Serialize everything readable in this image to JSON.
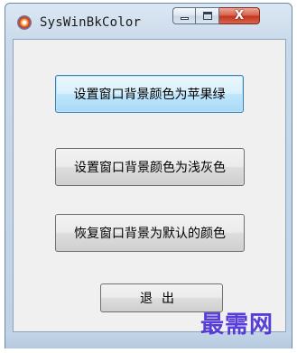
{
  "window": {
    "title": "SysWinBkColor",
    "icon": "color-wheel-icon",
    "caption": {
      "minimize": "minimize-icon",
      "maximize": "maximize-icon",
      "close": "close-icon",
      "close_glyph": "X"
    }
  },
  "buttons": {
    "apple_green": "设置窗口背景颜色为苹果绿",
    "light_gray": "设置窗口背景颜色为浅灰色",
    "restore_default": "恢复窗口背景为默认的颜色",
    "exit": "退出"
  },
  "watermark": "最需网",
  "colors": {
    "close_button": "#c2331c",
    "focus_border": "#3c7fb1",
    "watermark": "#4b2fd6"
  }
}
